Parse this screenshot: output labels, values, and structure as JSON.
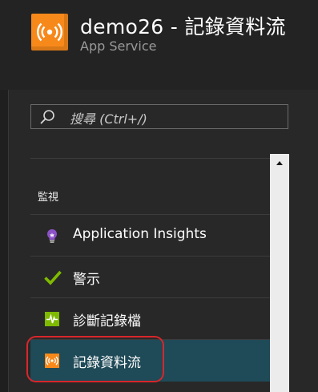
{
  "header": {
    "title": "demo26 - 記錄資料流",
    "subtitle": "App Service",
    "icon": "log-stream-icon",
    "icon_color": "#f7891b"
  },
  "search": {
    "placeholder": "搜尋 (Ctrl+/)",
    "icon": "search-icon"
  },
  "menu": {
    "section_label": "監視",
    "items": [
      {
        "label": "Application Insights",
        "icon": "lightbulb-icon",
        "icon_color": "#8b52c6",
        "selected": false
      },
      {
        "label": "警示",
        "icon": "checkmark-icon",
        "icon_color": "#7fba00",
        "selected": false
      },
      {
        "label": "診斷記錄檔",
        "icon": "diagnostics-icon",
        "icon_color": "#7fba00",
        "selected": false
      },
      {
        "label": "記錄資料流",
        "icon": "log-stream-icon",
        "icon_color": "#f7891b",
        "selected": true
      }
    ]
  },
  "colors": {
    "selected_background": "#1f4a57",
    "highlight_outline": "#d9262a"
  }
}
